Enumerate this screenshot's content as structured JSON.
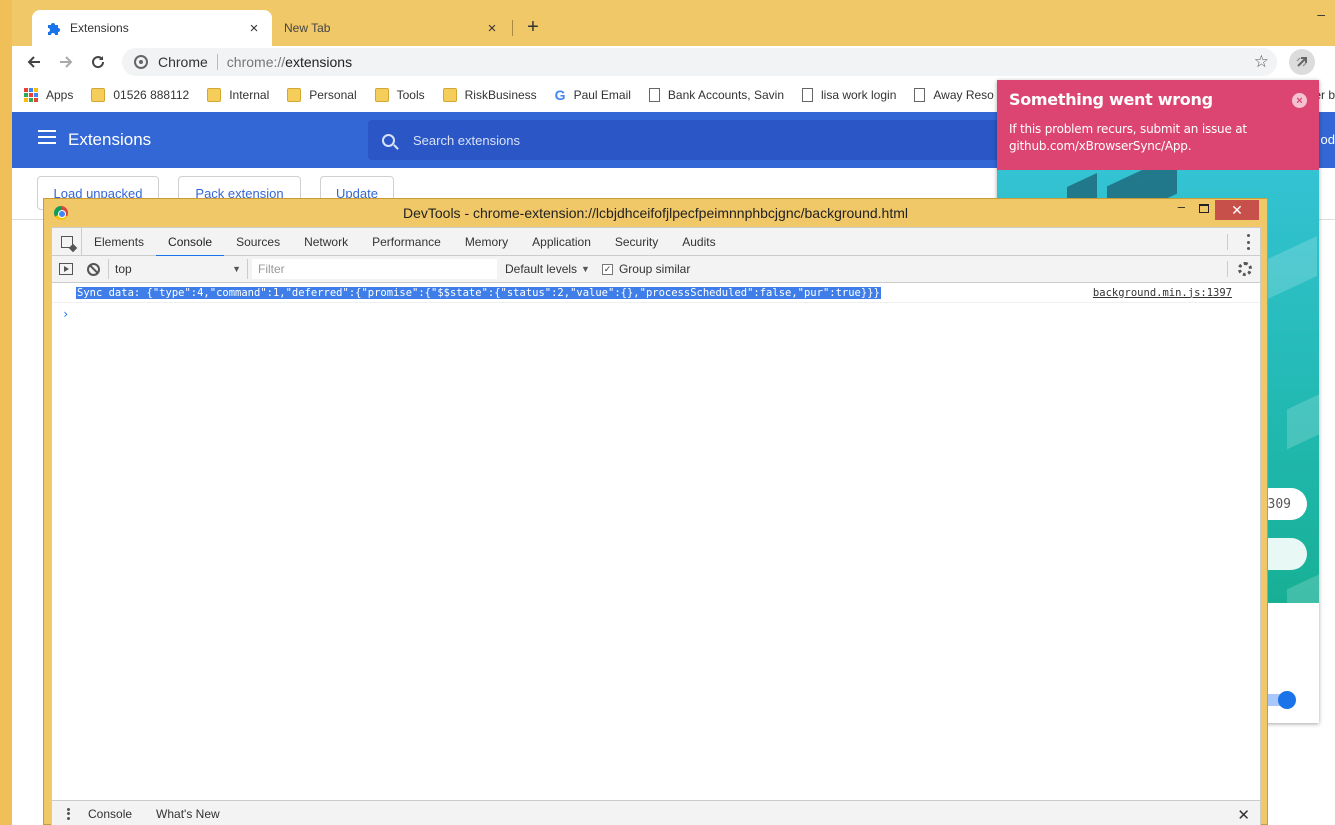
{
  "browser": {
    "tabs": [
      {
        "title": "Extensions",
        "icon": "puzzle-icon"
      },
      {
        "title": "New Tab"
      }
    ],
    "new_tab": "+",
    "minimize": "–",
    "omnibox": {
      "site_name": "Chrome",
      "url_scheme": "chrome://",
      "url_host": "extensions"
    }
  },
  "bookmarks": [
    {
      "label": "Apps",
      "icon": "apps-icon"
    },
    {
      "label": "01526 888112",
      "icon": "folder-icon"
    },
    {
      "label": "Internal",
      "icon": "folder-icon"
    },
    {
      "label": "Personal",
      "icon": "folder-icon"
    },
    {
      "label": "Tools",
      "icon": "folder-icon"
    },
    {
      "label": "RiskBusiness",
      "icon": "folder-icon"
    },
    {
      "label": "Paul Email",
      "icon": "google-icon"
    },
    {
      "label": "Bank Accounts, Savin",
      "icon": "page-icon"
    },
    {
      "label": "lisa work login",
      "icon": "page-icon"
    },
    {
      "label": "Away Reso",
      "icon": "page-icon"
    }
  ],
  "bookmarks_overflow": "er b",
  "extensions_page": {
    "title": "Extensions",
    "search_placeholder": "Search extensions",
    "right_text": "od",
    "buttons": {
      "load_unpacked": "Load unpacked",
      "pack_extension": "Pack extension",
      "update": "Update"
    }
  },
  "xbs_popup": {
    "alert_title": "Something went wrong",
    "alert_message": "If this problem recurs, submit an issue at github.com/xBrowserSync/App.",
    "pill_text": "309",
    "colors": {
      "alert": "#dc4572",
      "hero_top": "#33c3d3",
      "hero_bottom": "#17b095"
    }
  },
  "devtools": {
    "title": "DevTools - chrome-extension://lcbjdhceifofjlpecfpeimnnphbcjgnc/background.html",
    "tabs": [
      "Elements",
      "Console",
      "Sources",
      "Network",
      "Performance",
      "Memory",
      "Application",
      "Security",
      "Audits"
    ],
    "selected_tab": "Console",
    "context": "top",
    "filter_placeholder": "Filter",
    "levels": "Default levels",
    "group_similar": "Group similar",
    "log": {
      "text": "Sync data: {\"type\":4,\"command\":1,\"deferred\":{\"promise\":{\"$$state\":{\"status\":2,\"value\":{},\"processScheduled\":false,\"pur\":true}}}",
      "source": "background.min.js:1397"
    },
    "prompt": "›",
    "drawer_tabs": [
      "Console",
      "What's New"
    ]
  }
}
